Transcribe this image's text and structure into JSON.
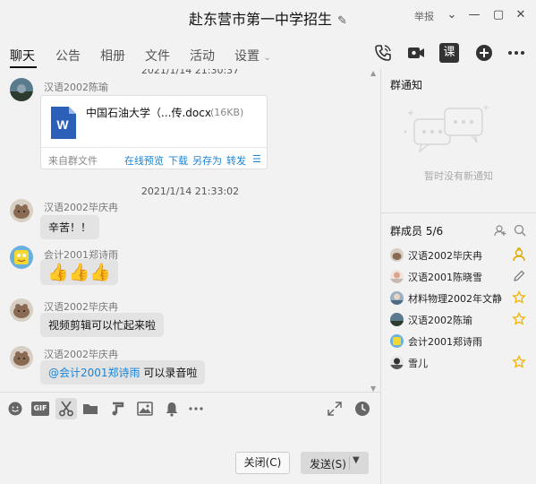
{
  "window": {
    "title": "赴东营市第一中学招生",
    "report": "举报"
  },
  "tabs": [
    {
      "label": "聊天"
    },
    {
      "label": "公告"
    },
    {
      "label": "相册"
    },
    {
      "label": "文件"
    },
    {
      "label": "活动"
    },
    {
      "label": "设置"
    }
  ],
  "toolbar": {
    "course_label": "课"
  },
  "chat": {
    "top_timestamp": "2021/1/14 21:30:37",
    "file_message": {
      "sender": "汉语2002陈瑜",
      "file_name": "中国石油大学（...传.docx",
      "file_size": "(16KB)",
      "source": "来自群文件",
      "action_preview": "在线预览",
      "action_download": "下载",
      "action_save_as": "另存为",
      "action_forward": "转发"
    },
    "timestamp2": "2021/1/14 21:33:02",
    "messages": [
      {
        "sender": "汉语2002毕庆冉",
        "text": "辛苦！！"
      },
      {
        "sender": "会计2001郑诗雨",
        "text": "👍👍👍"
      },
      {
        "sender": "汉语2002毕庆冉",
        "text": "视频剪辑可以忙起来啦"
      },
      {
        "sender": "汉语2002毕庆冉",
        "mention": "@会计2001郑诗雨",
        "text": " 可以录音啦"
      }
    ]
  },
  "composer": {
    "gif_label": "GIF",
    "close_label": "关闭(C)",
    "send_label": "发送(S)"
  },
  "notice": {
    "title": "群通知",
    "empty_text": "暂时没有新通知"
  },
  "members": {
    "title": "群成员 5/6",
    "list": [
      {
        "name": "汉语2002毕庆冉",
        "role_icon": "owner-icon"
      },
      {
        "name": "汉语2001陈晓雪",
        "role_icon": "edit-icon"
      },
      {
        "name": "材料物理2002年文静",
        "role_icon": "admin-star-icon"
      },
      {
        "name": "汉语2002陈瑜",
        "role_icon": "admin-star-icon"
      },
      {
        "name": "会计2001郑诗雨",
        "role_icon": ""
      },
      {
        "name": "雪儿",
        "role_icon": "admin-star-icon"
      }
    ]
  },
  "colors": {
    "accent": "#1a84d6",
    "star": "#f0b400",
    "word_blue": "#2b5fb8"
  }
}
